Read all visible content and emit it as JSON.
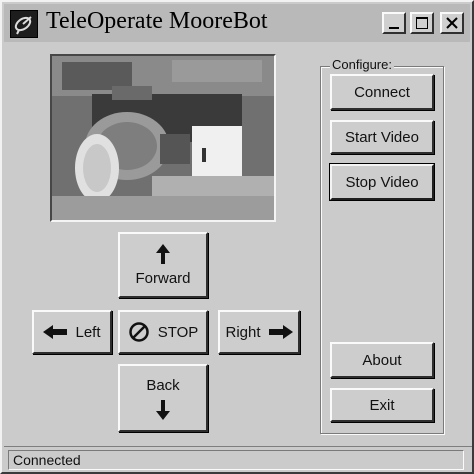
{
  "window": {
    "title": "TeleOperate MooreBot",
    "icon": "satellite-dish-icon"
  },
  "titlebar_buttons": {
    "minimize_icon": "minimize-icon",
    "maximize_icon": "maximize-icon",
    "close_icon": "close-icon"
  },
  "drive": {
    "forward_label": "Forward",
    "back_label": "Back",
    "left_label": "Left",
    "right_label": "Right",
    "stop_label": "STOP"
  },
  "configure": {
    "group_label": "Configure:",
    "connect_label": "Connect",
    "start_video_label": "Start Video",
    "stop_video_label": "Stop Video",
    "about_label": "About",
    "exit_label": "Exit"
  },
  "status": {
    "text": "Connected"
  },
  "colors": {
    "face": "#cbcbcb",
    "highlight": "#fafafa",
    "shadow": "#2e2e2e"
  }
}
